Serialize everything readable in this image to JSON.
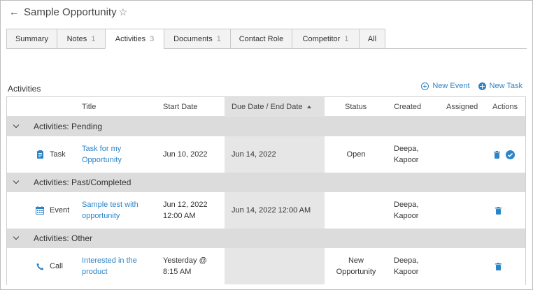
{
  "header": {
    "title": "Sample Opportunity"
  },
  "tabs": [
    {
      "label": "Summary",
      "count": ""
    },
    {
      "label": "Notes",
      "count": "1"
    },
    {
      "label": "Activities",
      "count": "3"
    },
    {
      "label": "Documents",
      "count": "1"
    },
    {
      "label": "Contact Role",
      "count": ""
    },
    {
      "label": "Competitor",
      "count": "1"
    },
    {
      "label": "All",
      "count": ""
    }
  ],
  "active_tab": "Activities",
  "section": {
    "title": "Activities",
    "new_event": "New Event",
    "new_task": "New Task"
  },
  "columns": {
    "title": "Title",
    "start": "Start Date",
    "due": "Due Date / End Date",
    "status": "Status",
    "created": "Created",
    "assigned": "Assigned",
    "actions": "Actions"
  },
  "groups": [
    {
      "label": "Activities: Pending",
      "row": {
        "type": "Task",
        "title": [
          "Task for my",
          "Opportunity"
        ],
        "start": [
          "Jun 10, 2022",
          ""
        ],
        "due": "Jun 14, 2022",
        "status": [
          "Open",
          ""
        ],
        "created": [
          "Deepa,",
          "Kapoor"
        ],
        "assigned": ""
      }
    },
    {
      "label": "Activities: Past/Completed",
      "row": {
        "type": "Event",
        "title": [
          "Sample test with",
          "opportunity"
        ],
        "start": [
          "Jun 12, 2022",
          "12:00 AM"
        ],
        "due": "Jun 14, 2022 12:00 AM",
        "status": [
          "",
          ""
        ],
        "created": [
          "Deepa,",
          "Kapoor"
        ],
        "assigned": ""
      }
    },
    {
      "label": "Activities: Other",
      "row": {
        "type": "Call",
        "title": [
          "Interested in the",
          "product"
        ],
        "start": [
          "Yesterday @",
          "8:15 AM"
        ],
        "due": "",
        "status": [
          "New",
          "Opportunity"
        ],
        "created": [
          "Deepa,",
          "Kapoor"
        ],
        "assigned": ""
      }
    }
  ],
  "colors": {
    "link": "#2c84c8",
    "group_bg": "#dcdcdc",
    "sorted_col": "#e6e6e6"
  }
}
